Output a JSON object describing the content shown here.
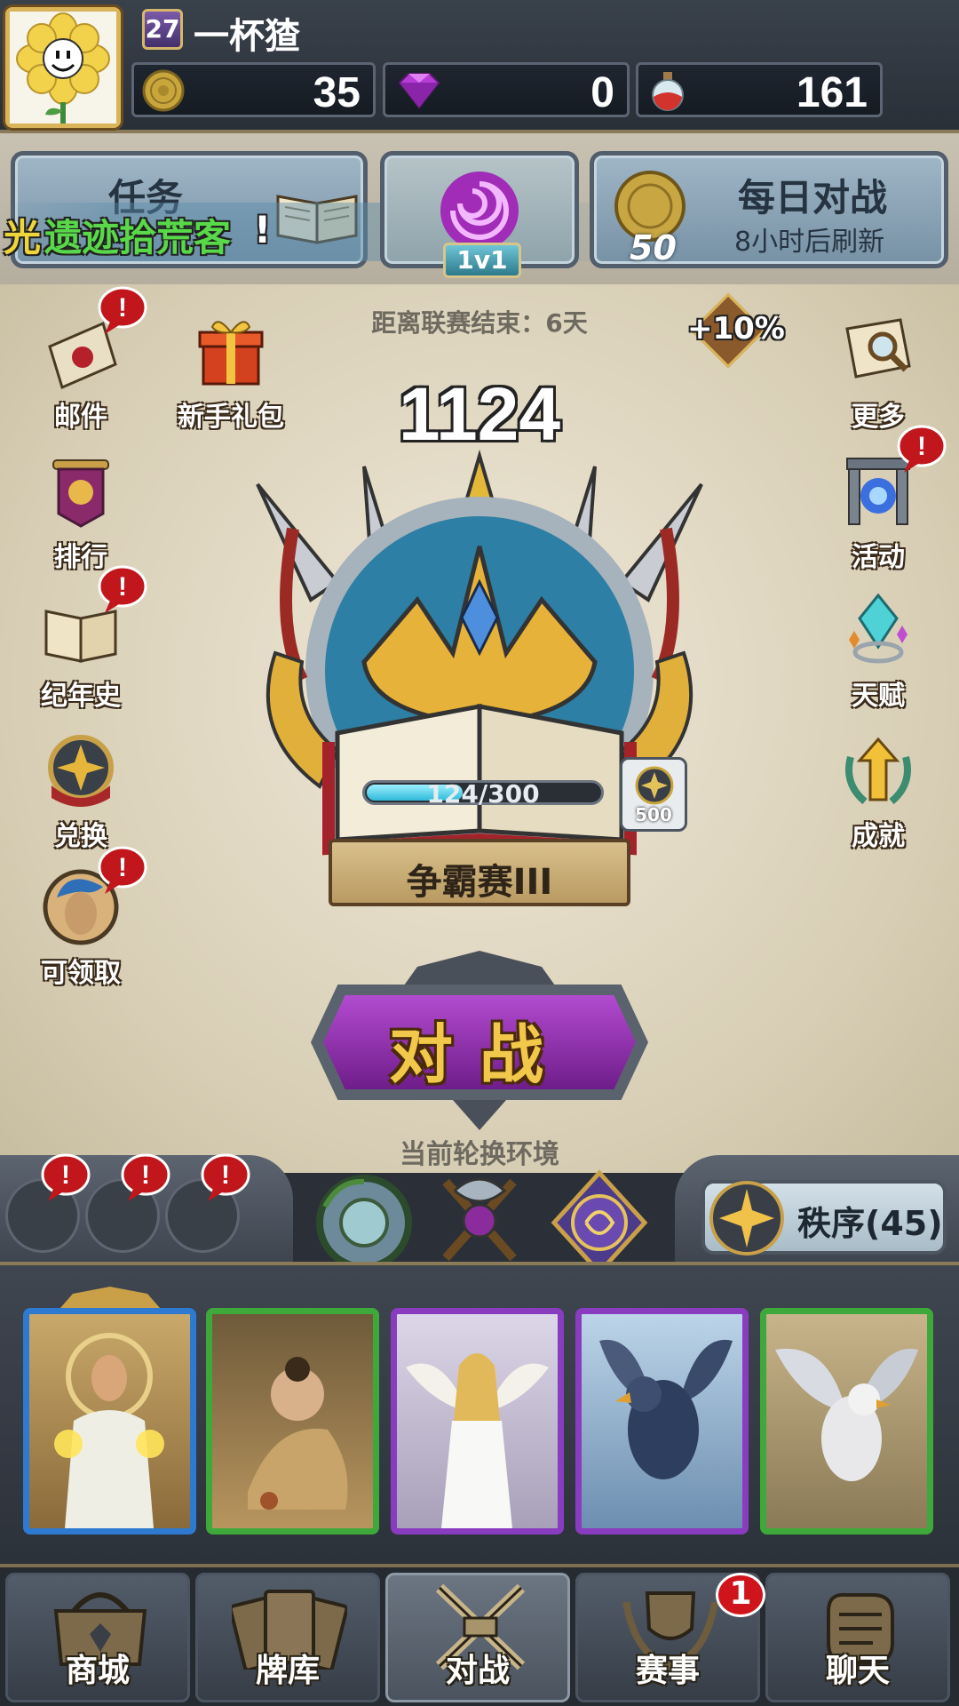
{
  "player": {
    "level": "27",
    "name": "一杯猹"
  },
  "resources": [
    {
      "icon": "gold-coin-icon",
      "value": "35"
    },
    {
      "icon": "purple-gem-icon",
      "value": "0"
    },
    {
      "icon": "potion-flask-icon",
      "value": "161"
    }
  ],
  "modes": {
    "quest_title": "任务",
    "ticker_text_prefix": "光",
    "ticker_text_green": "遗迹拾荒客",
    "ticker_text_suffix": "!",
    "center_mode_label": "1v1",
    "daily_title": "每日对战",
    "daily_subtitle": "8小时后刷新",
    "daily_reward": "50"
  },
  "league": {
    "countdown": "距离联赛结束：6天",
    "bonus": "+10%",
    "rating": "1124",
    "progress_text": "124/300",
    "progress_fraction": 0.413,
    "reward_amount": "500",
    "rank_name": "争霸赛III"
  },
  "left_menu": [
    {
      "label": "邮件",
      "icon": "mail-envelope-icon",
      "alert": true
    },
    {
      "label": "新手礼包",
      "icon": "gift-box-icon",
      "alert": false
    },
    {
      "label": "排行",
      "icon": "ranking-banner-icon",
      "alert": false
    },
    {
      "label": "纪年史",
      "icon": "open-book-icon",
      "alert": true
    },
    {
      "label": "兑换",
      "icon": "exchange-medal-icon",
      "alert": false
    },
    {
      "label": "可领取",
      "icon": "hero-portrait-icon",
      "alert": true
    }
  ],
  "right_menu": [
    {
      "label": "更多",
      "icon": "scroll-magnifier-icon",
      "alert": false
    },
    {
      "label": "活动",
      "icon": "portal-gate-icon",
      "alert": true
    },
    {
      "label": "天赋",
      "icon": "crystal-icon",
      "alert": false
    },
    {
      "label": "成就",
      "icon": "laurel-arrow-icon",
      "alert": false
    }
  ],
  "battle": {
    "button_label": "对战",
    "environment_label": "当前轮换环境"
  },
  "environment": {
    "faction_label": "秩序(45)"
  },
  "nav": [
    {
      "label": "商城",
      "icon": "shop-icon",
      "badge": ""
    },
    {
      "label": "牌库",
      "icon": "card-deck-icon",
      "badge": ""
    },
    {
      "label": "对战",
      "icon": "crossed-swords-icon",
      "badge": ""
    },
    {
      "label": "赛事",
      "icon": "tournament-shield-icon",
      "badge": "1"
    },
    {
      "label": "聊天",
      "icon": "chat-fist-icon",
      "badge": ""
    }
  ],
  "colors": {
    "accent_gold": "#d9b45a",
    "battle_purple": "#8a2fa0",
    "alert_red": "#c0161c"
  }
}
